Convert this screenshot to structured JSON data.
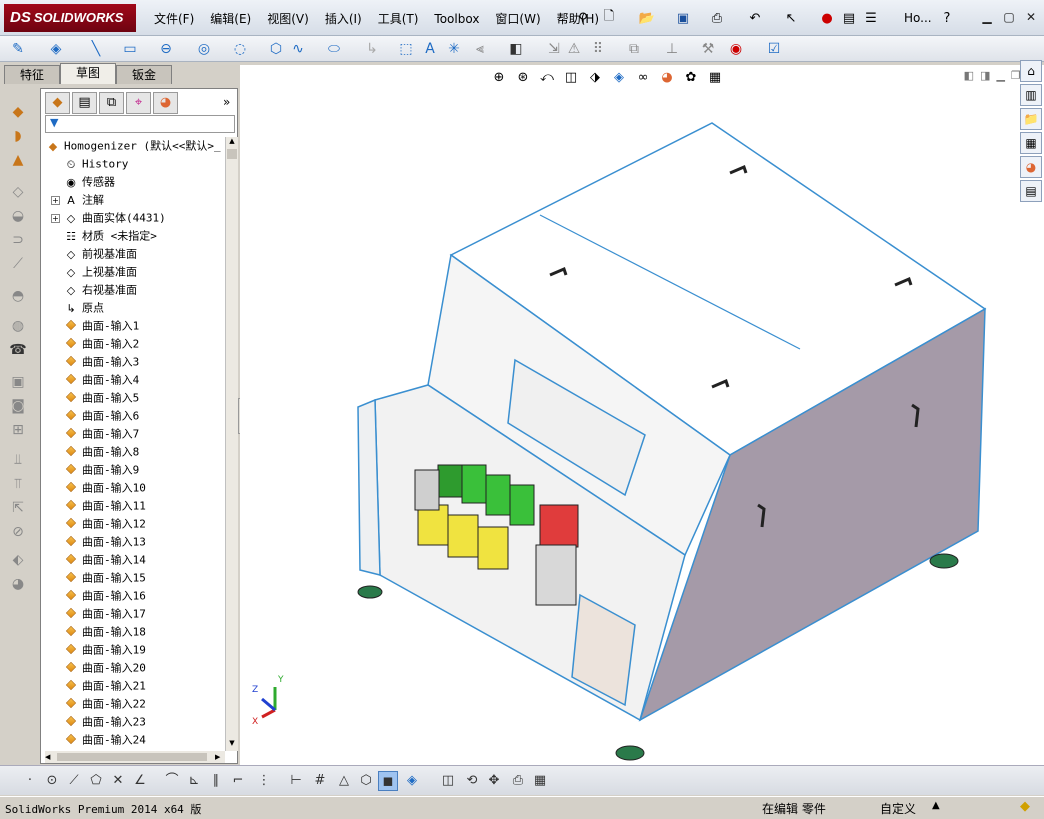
{
  "app": {
    "logo_prefix": "DS",
    "logo_text": "SOLIDWORKS",
    "window_short": "Ho..."
  },
  "menu": [
    "文件(F)",
    "编辑(E)",
    "视图(V)",
    "插入(I)",
    "工具(T)",
    "Toolbox",
    "窗口(W)",
    "帮助(H)"
  ],
  "cm_tabs": [
    "特征",
    "草图",
    "钣金"
  ],
  "cm_active": "草图",
  "tree": {
    "root": "Homogenizer  (默认<<默认>_",
    "items": [
      {
        "label": "History",
        "icon": "history-icon",
        "expander": false
      },
      {
        "label": "传感器",
        "icon": "sensor-icon",
        "expander": false
      },
      {
        "label": "注解",
        "icon": "annotation-icon",
        "expander": true
      },
      {
        "label": "曲面实体(4431)",
        "icon": "surface-bodies-icon",
        "expander": true
      },
      {
        "label": "材质 <未指定>",
        "icon": "material-icon",
        "expander": false
      },
      {
        "label": "前视基准面",
        "icon": "plane-icon",
        "expander": false
      },
      {
        "label": "上视基准面",
        "icon": "plane-icon",
        "expander": false
      },
      {
        "label": "右视基准面",
        "icon": "plane-icon",
        "expander": false
      },
      {
        "label": "原点",
        "icon": "origin-icon",
        "expander": false
      },
      {
        "label": "曲面-输入1",
        "icon": "imported-surface-icon",
        "expander": false
      },
      {
        "label": "曲面-输入2",
        "icon": "imported-surface-icon",
        "expander": false
      },
      {
        "label": "曲面-输入3",
        "icon": "imported-surface-icon",
        "expander": false
      },
      {
        "label": "曲面-输入4",
        "icon": "imported-surface-icon",
        "expander": false
      },
      {
        "label": "曲面-输入5",
        "icon": "imported-surface-icon",
        "expander": false
      },
      {
        "label": "曲面-输入6",
        "icon": "imported-surface-icon",
        "expander": false
      },
      {
        "label": "曲面-输入7",
        "icon": "imported-surface-icon",
        "expander": false
      },
      {
        "label": "曲面-输入8",
        "icon": "imported-surface-icon",
        "expander": false
      },
      {
        "label": "曲面-输入9",
        "icon": "imported-surface-icon",
        "expander": false
      },
      {
        "label": "曲面-输入10",
        "icon": "imported-surface-icon",
        "expander": false
      },
      {
        "label": "曲面-输入11",
        "icon": "imported-surface-icon",
        "expander": false
      },
      {
        "label": "曲面-输入12",
        "icon": "imported-surface-icon",
        "expander": false
      },
      {
        "label": "曲面-输入13",
        "icon": "imported-surface-icon",
        "expander": false
      },
      {
        "label": "曲面-输入14",
        "icon": "imported-surface-icon",
        "expander": false
      },
      {
        "label": "曲面-输入15",
        "icon": "imported-surface-icon",
        "expander": false
      },
      {
        "label": "曲面-输入16",
        "icon": "imported-surface-icon",
        "expander": false
      },
      {
        "label": "曲面-输入17",
        "icon": "imported-surface-icon",
        "expander": false
      },
      {
        "label": "曲面-输入18",
        "icon": "imported-surface-icon",
        "expander": false
      },
      {
        "label": "曲面-输入19",
        "icon": "imported-surface-icon",
        "expander": false
      },
      {
        "label": "曲面-输入20",
        "icon": "imported-surface-icon",
        "expander": false
      },
      {
        "label": "曲面-输入21",
        "icon": "imported-surface-icon",
        "expander": false
      },
      {
        "label": "曲面-输入22",
        "icon": "imported-surface-icon",
        "expander": false
      },
      {
        "label": "曲面-输入23",
        "icon": "imported-surface-icon",
        "expander": false
      },
      {
        "label": "曲面-输入24",
        "icon": "imported-surface-icon",
        "expander": false
      }
    ]
  },
  "triad": {
    "y": "Y",
    "z": "Z",
    "x": "X"
  },
  "status": {
    "product": "SolidWorks Premium 2014 x64 版",
    "mode": "在编辑 零件",
    "units": "自定义"
  },
  "colors": {
    "accent": "#a1091a",
    "model_edge": "#3a8fd0",
    "panel_side": "#a59aa8"
  }
}
